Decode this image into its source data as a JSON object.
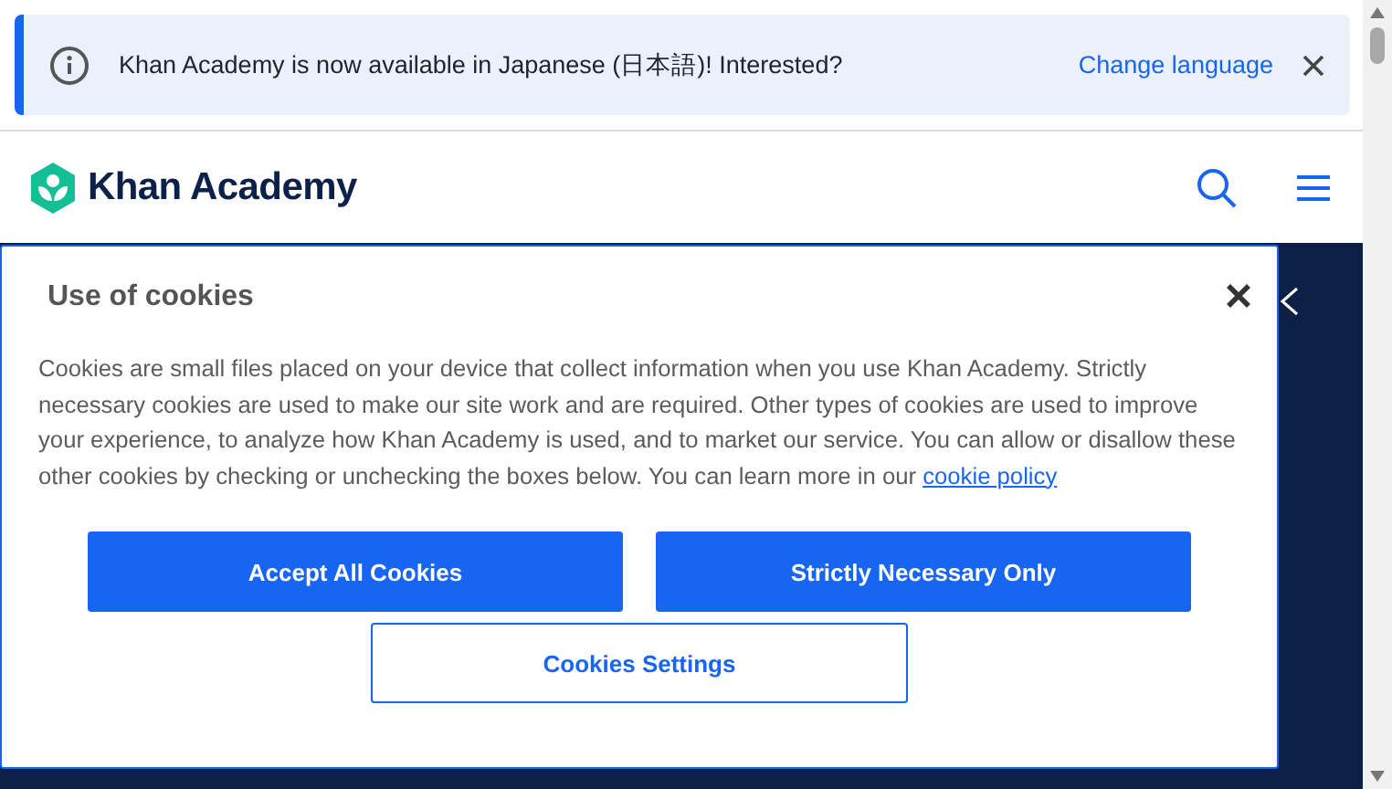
{
  "banner": {
    "message": "Khan Academy is now available in Japanese (日本語)! Interested?",
    "link": "Change language"
  },
  "header": {
    "logo_text": "Khan Academy"
  },
  "cookie_dialog": {
    "title": "Use of cookies",
    "body": "Cookies are small files placed on your device that collect information when you use Khan Academy. Strictly necessary cookies are used to make our site work and are required. Other types of cookies are used to improve your experience, to analyze how Khan Academy is used, and to market our service. You can allow or disallow these other cookies by checking or unchecking the boxes below. You can learn more in our",
    "link": "cookie policy",
    "buttons": [
      {
        "label": "Accept All Cookies",
        "kind": "primary"
      },
      {
        "label": "Strictly Necessary Only",
        "kind": "primary"
      },
      {
        "label": "Cookies Settings",
        "kind": "outline"
      }
    ]
  }
}
